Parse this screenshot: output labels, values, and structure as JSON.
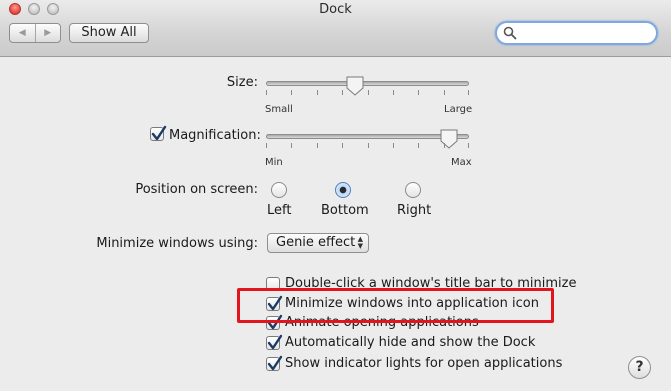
{
  "window": {
    "title": "Dock"
  },
  "toolbar": {
    "back_glyph": "◀",
    "forward_glyph": "▶",
    "show_all_label": "Show All",
    "search_value": ""
  },
  "size": {
    "label": "Size:",
    "min_label": "Small",
    "max_label": "Large",
    "value": 0.44
  },
  "magnification": {
    "label": "Magnification:",
    "checked": true,
    "min_label": "Min",
    "max_label": "Max",
    "value": 0.9
  },
  "position": {
    "label": "Position on screen:",
    "options": [
      {
        "label": "Left",
        "selected": false
      },
      {
        "label": "Bottom",
        "selected": true
      },
      {
        "label": "Right",
        "selected": false
      }
    ]
  },
  "minimize": {
    "label": "Minimize windows using:",
    "selected": "Genie effect"
  },
  "options": [
    {
      "label": "Double-click a window's title bar to minimize",
      "checked": false
    },
    {
      "label": "Minimize windows into application icon",
      "checked": true
    },
    {
      "label": "Animate opening applications",
      "checked": true
    },
    {
      "label": "Automatically hide and show the Dock",
      "checked": true
    },
    {
      "label": "Show indicator lights for open applications",
      "checked": true
    }
  ],
  "help": {
    "glyph": "?"
  },
  "colors": {
    "highlight_border": "#e2141c",
    "accent": "#4f7ec1"
  }
}
